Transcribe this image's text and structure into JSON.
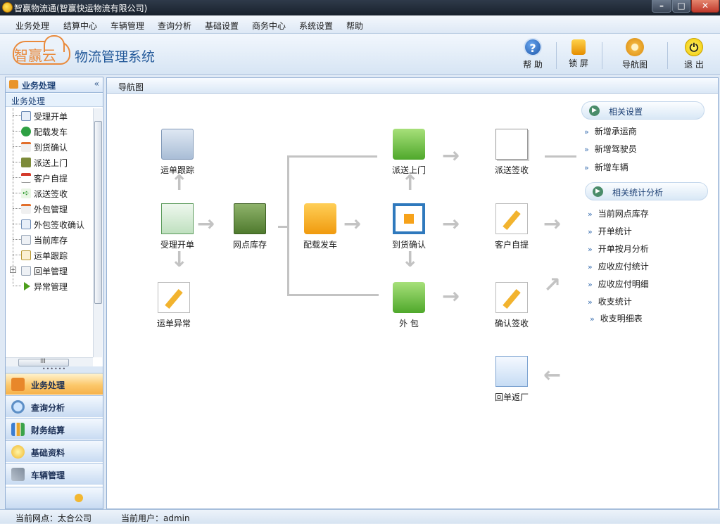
{
  "window": {
    "title": "智赢物流通(智赢快运物流有限公司)",
    "minimize": "–",
    "maximize": "□",
    "close": "✕"
  },
  "menu": [
    "业务处理",
    "结算中心",
    "车辆管理",
    "查询分析",
    "基础设置",
    "商务中心",
    "系统设置",
    "帮助"
  ],
  "brand": {
    "logo_text": "智赢云",
    "system_name": "物流管理系统",
    "logo_color": "#e98a3c"
  },
  "toolbar": [
    {
      "label": "帮 助",
      "icon": "help-icon"
    },
    {
      "label": "锁 屏",
      "icon": "lock-icon"
    },
    {
      "label": "导航图",
      "icon": "gear-icon"
    },
    {
      "label": "退 出",
      "icon": "power-icon"
    }
  ],
  "sidebar": {
    "header": "业务处理",
    "collapse": "«",
    "section": "业务处理",
    "tree": [
      {
        "label": "受理开单",
        "icon": "form-icon"
      },
      {
        "label": "配载发车",
        "icon": "check-icon"
      },
      {
        "label": "到货确认",
        "icon": "arrow-doc-icon"
      },
      {
        "label": "派送上门",
        "icon": "box-icon"
      },
      {
        "label": "客户自提",
        "icon": "calendar-icon"
      },
      {
        "label": "派送签收",
        "icon": "green-arrow-icon"
      },
      {
        "label": "外包管理",
        "icon": "arrow-doc-icon"
      },
      {
        "label": "外包签收确认",
        "icon": "form-icon"
      },
      {
        "label": "当前库存",
        "icon": "window-icon"
      },
      {
        "label": "运单跟踪",
        "icon": "card-icon"
      },
      {
        "label": "回单管理",
        "icon": "window-icon"
      },
      {
        "label": "异常管理",
        "icon": "play-icon"
      }
    ],
    "hscroll_label": "III",
    "grip": "••••••",
    "nav": [
      {
        "label": "业务处理",
        "icon": "box-icon",
        "active": true
      },
      {
        "label": "查询分析",
        "icon": "magnifier-icon",
        "active": false
      },
      {
        "label": "财务结算",
        "icon": "bar-chart-icon",
        "active": false
      },
      {
        "label": "基础资料",
        "icon": "bulb-icon",
        "active": false
      },
      {
        "label": "车辆管理",
        "icon": "wrench-icon",
        "active": false
      }
    ]
  },
  "main": {
    "tab": "导航图",
    "nodes": {
      "track": "运单跟踪",
      "accept": "受理开单",
      "exception": "运单异常",
      "stock": "网点库存",
      "dispatch": "配载发车",
      "deliver": "派送上门",
      "arrive": "到货确认",
      "outsource": "外 包",
      "deliver_sign": "派送签收",
      "self_pick": "客户自提",
      "confirm_sign": "确认签收",
      "receipt_return": "回单返厂"
    },
    "settings": {
      "title": "相关设置",
      "links": [
        "新增承运商",
        "新增驾驶员",
        "新增车辆"
      ]
    },
    "stats": {
      "title": "相关统计分析",
      "links": [
        "当前网点库存",
        "开单统计",
        "开单按月分析",
        "应收应付统计",
        "应收应付明细",
        "收支统计",
        "收支明细表"
      ]
    },
    "link_marker": "»"
  },
  "status": {
    "site": "当前网点：太合公司",
    "user": "当前用户：admin"
  }
}
